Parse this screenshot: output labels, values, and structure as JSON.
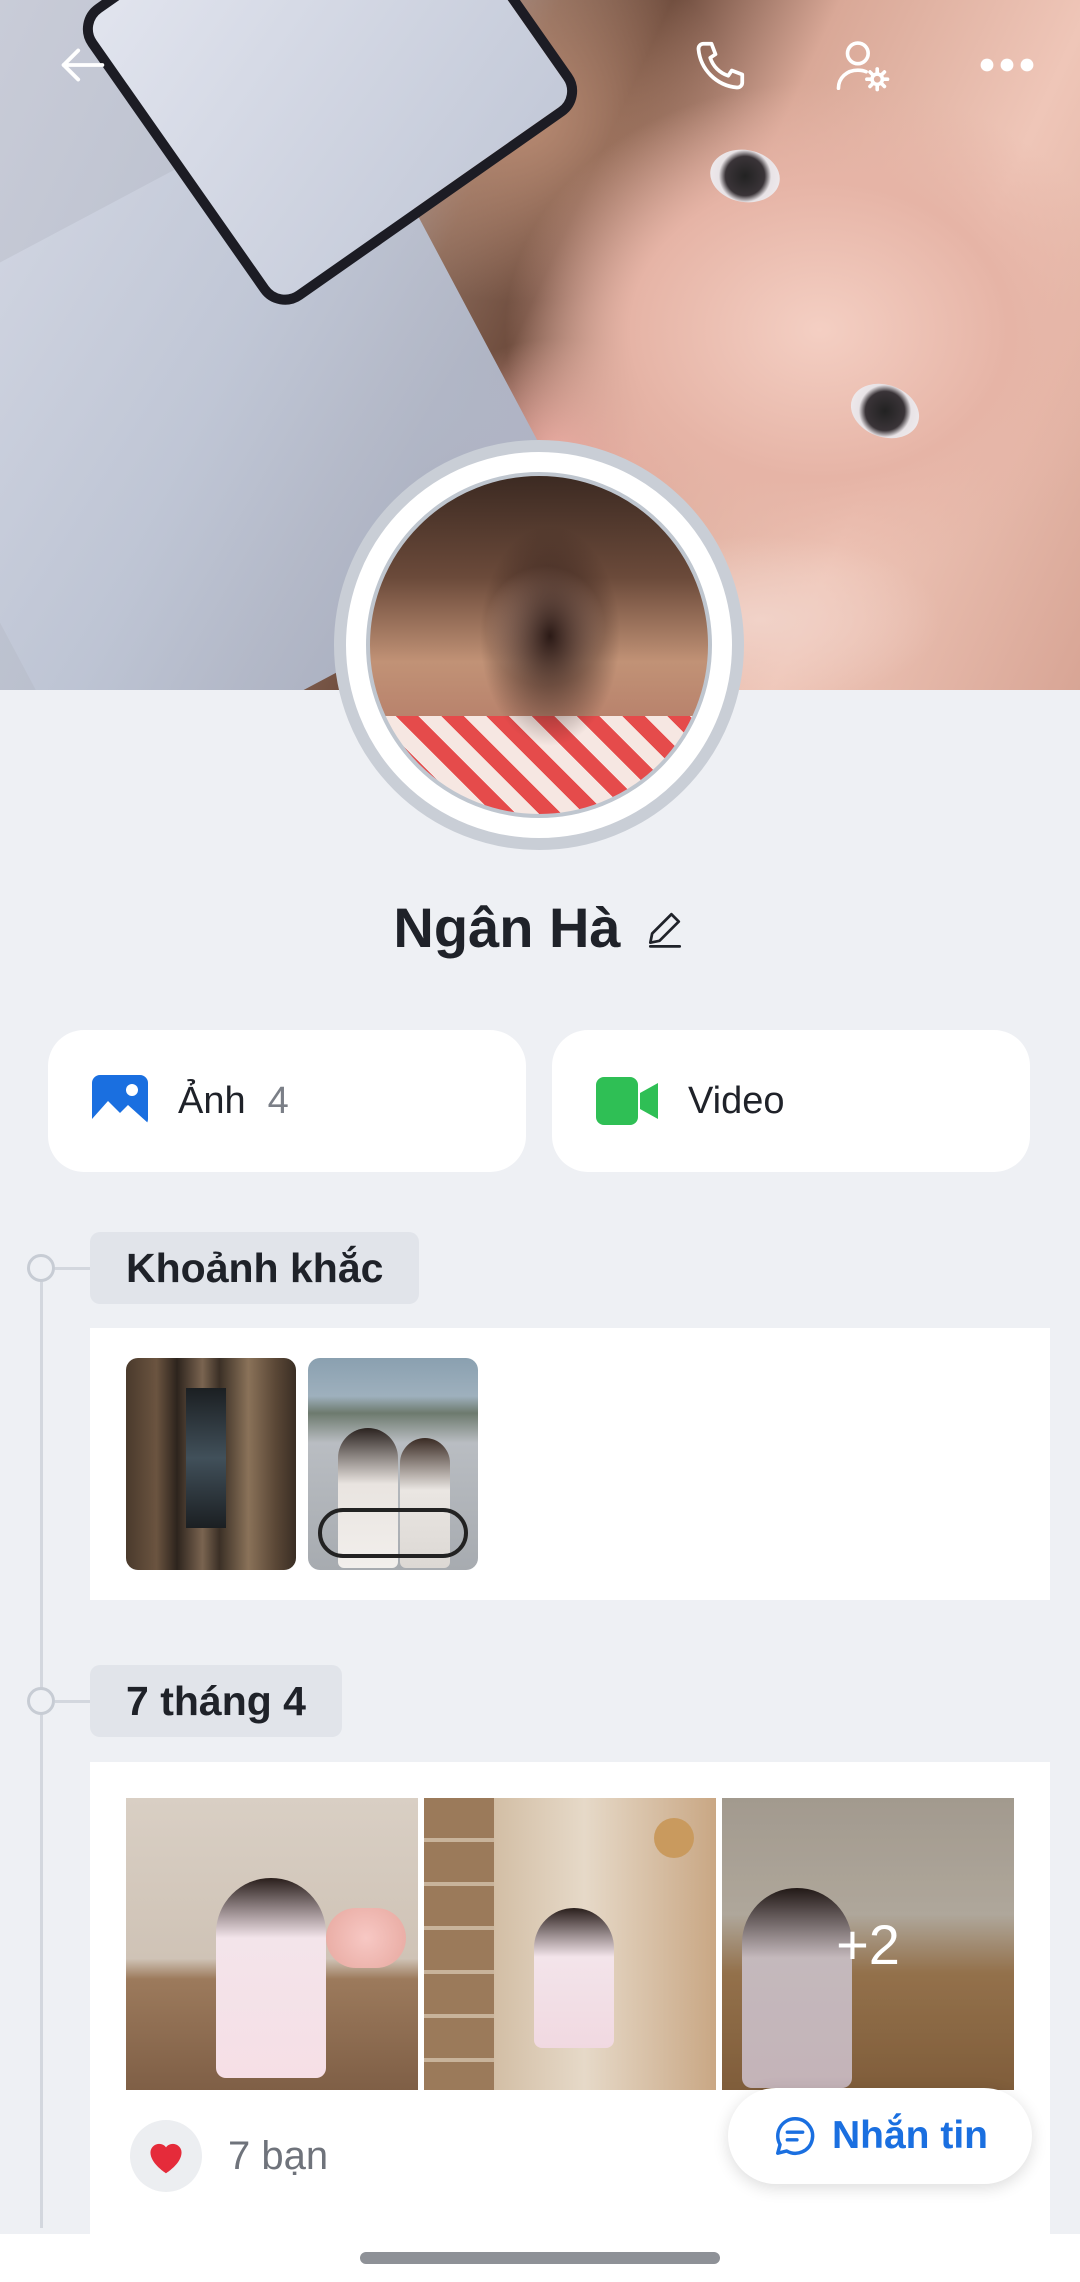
{
  "header": {
    "back_icon": "arrow-left-icon",
    "call_icon": "phone-icon",
    "settings_icon": "user-settings-icon",
    "more_icon": "more-dots-icon"
  },
  "profile": {
    "name": "Ngân Hà",
    "edit_icon": "pencil-icon"
  },
  "media": {
    "photos_label": "Ảnh",
    "photos_count": "4",
    "video_label": "Video",
    "photo_icon_color": "#1a6fe0",
    "video_icon_color": "#2fbf55"
  },
  "timeline": {
    "moments_title": "Khoảnh khắc",
    "post_date": "7 tháng 4",
    "more_photos": "+2",
    "friends_reacted": "7 bạn",
    "reaction_icon": "heart-icon"
  },
  "actions": {
    "message_label": "Nhắn tin",
    "message_icon": "chat-bubble-icon",
    "accent": "#1a6fe0"
  }
}
